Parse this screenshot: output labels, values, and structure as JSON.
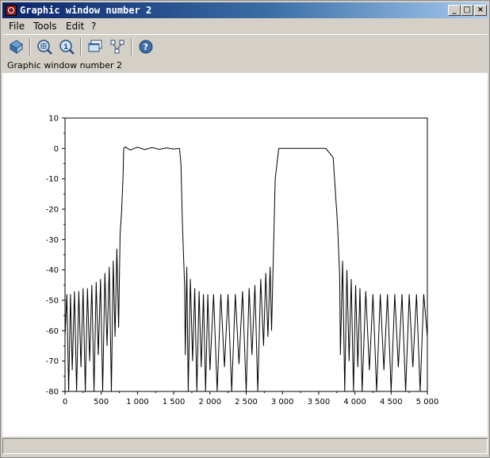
{
  "window": {
    "title": "Graphic window number 2"
  },
  "menu": {
    "items": [
      "File",
      "Tools",
      "Edit",
      "?"
    ]
  },
  "toolbar": {
    "buttons": [
      "rotate-icon",
      "zoom-icon",
      "unzoom-icon",
      "copy-window-icon",
      "datatip-icon",
      "help-icon"
    ]
  },
  "info": {
    "text": "Graphic window number 2"
  },
  "status": {
    "text": ""
  },
  "chart_data": {
    "type": "line",
    "title": "",
    "xlabel": "",
    "ylabel": "",
    "xlim": [
      0,
      5000
    ],
    "ylim": [
      -80,
      10
    ],
    "xticks": [
      0,
      500,
      1000,
      1500,
      2000,
      2500,
      3000,
      3500,
      4000,
      4500,
      5000
    ],
    "xtick_labels": [
      "0",
      "500",
      "1 000",
      "1 500",
      "2 000",
      "2 500",
      "3 000",
      "3 500",
      "4 000",
      "4 500",
      "5 000"
    ],
    "yticks": [
      10,
      0,
      -10,
      -20,
      -30,
      -40,
      -50,
      -60,
      -70,
      -80
    ],
    "ytick_labels": [
      "10",
      "0",
      "-10",
      "-20",
      "-30",
      "-40",
      "-50",
      "-60",
      "-70",
      "-80"
    ],
    "grid": false,
    "series": [
      {
        "values": [
          [
            0,
            -62
          ],
          [
            25,
            -48
          ],
          [
            50,
            -80
          ],
          [
            75,
            -48
          ],
          [
            100,
            -73
          ],
          [
            130,
            -47
          ],
          [
            160,
            -80
          ],
          [
            190,
            -47
          ],
          [
            220,
            -72
          ],
          [
            250,
            -46
          ],
          [
            280,
            -80
          ],
          [
            310,
            -46
          ],
          [
            340,
            -70
          ],
          [
            370,
            -45
          ],
          [
            400,
            -80
          ],
          [
            430,
            -44
          ],
          [
            460,
            -68
          ],
          [
            490,
            -43
          ],
          [
            520,
            -80
          ],
          [
            550,
            -41
          ],
          [
            580,
            -65
          ],
          [
            610,
            -39
          ],
          [
            640,
            -80
          ],
          [
            665,
            -37
          ],
          [
            690,
            -62
          ],
          [
            715,
            -33
          ],
          [
            740,
            -59
          ],
          [
            760,
            -28
          ],
          [
            780,
            -21
          ],
          [
            800,
            -10
          ],
          [
            810,
            0
          ],
          [
            830,
            0.5
          ],
          [
            900,
            -0.5
          ],
          [
            1000,
            0.4
          ],
          [
            1100,
            -0.4
          ],
          [
            1200,
            0.3
          ],
          [
            1300,
            -0.3
          ],
          [
            1400,
            0.2
          ],
          [
            1500,
            -0.2
          ],
          [
            1580,
            0
          ],
          [
            1600,
            -5
          ],
          [
            1620,
            -25
          ],
          [
            1650,
            -45
          ],
          [
            1660,
            -68
          ],
          [
            1680,
            -39
          ],
          [
            1700,
            -80
          ],
          [
            1730,
            -43
          ],
          [
            1760,
            -70
          ],
          [
            1790,
            -46
          ],
          [
            1820,
            -80
          ],
          [
            1850,
            -47
          ],
          [
            1880,
            -72
          ],
          [
            1910,
            -48
          ],
          [
            1940,
            -80
          ],
          [
            1970,
            -48
          ],
          [
            2000,
            -73
          ],
          [
            2050,
            -48
          ],
          [
            2100,
            -80
          ],
          [
            2150,
            -48
          ],
          [
            2200,
            -72
          ],
          [
            2250,
            -48
          ],
          [
            2300,
            -80
          ],
          [
            2350,
            -48
          ],
          [
            2400,
            -71
          ],
          [
            2450,
            -47
          ],
          [
            2500,
            -80
          ],
          [
            2540,
            -46
          ],
          [
            2580,
            -68
          ],
          [
            2620,
            -45
          ],
          [
            2660,
            -80
          ],
          [
            2700,
            -43
          ],
          [
            2740,
            -65
          ],
          [
            2770,
            -41
          ],
          [
            2800,
            -62
          ],
          [
            2830,
            -39
          ],
          [
            2850,
            -60
          ],
          [
            2900,
            -10
          ],
          [
            2950,
            0
          ],
          [
            3000,
            0
          ],
          [
            3300,
            0
          ],
          [
            3600,
            0
          ],
          [
            3700,
            -3
          ],
          [
            3760,
            -25
          ],
          [
            3790,
            -42
          ],
          [
            3800,
            -68
          ],
          [
            3830,
            -37
          ],
          [
            3860,
            -80
          ],
          [
            3890,
            -40
          ],
          [
            3920,
            -70
          ],
          [
            3950,
            -43
          ],
          [
            3980,
            -80
          ],
          [
            4010,
            -45
          ],
          [
            4040,
            -72
          ],
          [
            4070,
            -46
          ],
          [
            4100,
            -80
          ],
          [
            4150,
            -47
          ],
          [
            4200,
            -73
          ],
          [
            4250,
            -48
          ],
          [
            4300,
            -80
          ],
          [
            4350,
            -48
          ],
          [
            4400,
            -73
          ],
          [
            4450,
            -48
          ],
          [
            4500,
            -80
          ],
          [
            4550,
            -48
          ],
          [
            4600,
            -72
          ],
          [
            4650,
            -48
          ],
          [
            4700,
            -80
          ],
          [
            4750,
            -48
          ],
          [
            4800,
            -72
          ],
          [
            4850,
            -48
          ],
          [
            4900,
            -80
          ],
          [
            4950,
            -48
          ],
          [
            5000,
            -62
          ]
        ]
      }
    ]
  }
}
